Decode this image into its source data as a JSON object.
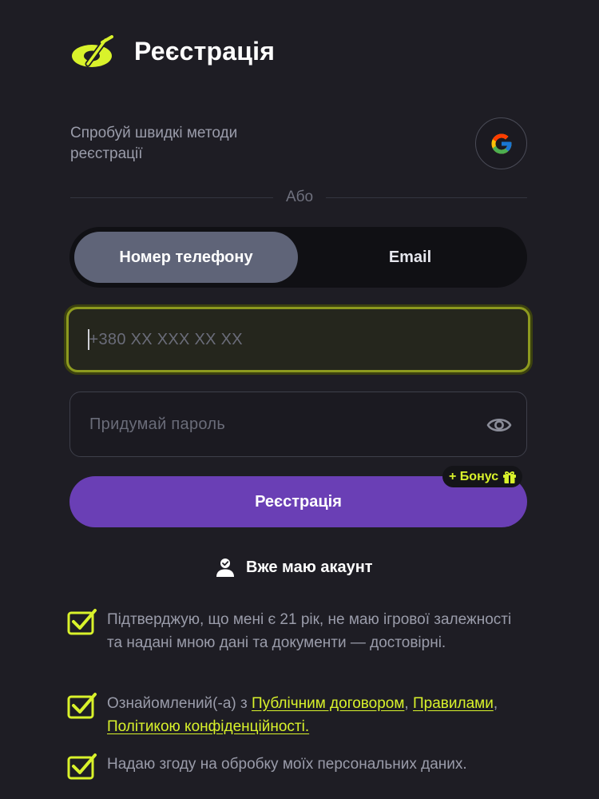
{
  "header": {
    "title": "Реєстрація"
  },
  "quick": {
    "text": "Спробуй швидкі методи реєстрації"
  },
  "divider": {
    "text": "Або"
  },
  "tabs": [
    {
      "label": "Номер телефону",
      "active": true
    },
    {
      "label": "Email",
      "active": false
    }
  ],
  "phone": {
    "placeholder": "+380 XX XXX XX XX",
    "value": ""
  },
  "password": {
    "placeholder": "Придумай пароль",
    "value": ""
  },
  "register": {
    "label": "Реєстрація",
    "bonus": "+ Бонус"
  },
  "login": {
    "label": "Вже маю акаунт"
  },
  "agreements": {
    "age": "Підтверджую, що мені є 21 рік, не маю ігрової залежності та надані мною дані та документи — достовірні.",
    "terms_prefix": "Ознайомлений(-а) з ",
    "terms_link1": "Публічним договором",
    "terms_sep": ", ",
    "terms_link2": "Правилами",
    "terms_sep2": ", ",
    "terms_link3": "Політикою конфіденційності.",
    "data": "Надаю згоду на обробку моїх персональних даних."
  },
  "colors": {
    "background": "#1e1d24",
    "accent": "#d9f22b",
    "primary_button": "#6a3fb5",
    "active_tab": "#5f6478"
  },
  "icons": [
    "brand-logo-icon",
    "google-icon",
    "eye-icon",
    "gift-icon",
    "user-icon",
    "checkbox-checked-icon"
  ]
}
